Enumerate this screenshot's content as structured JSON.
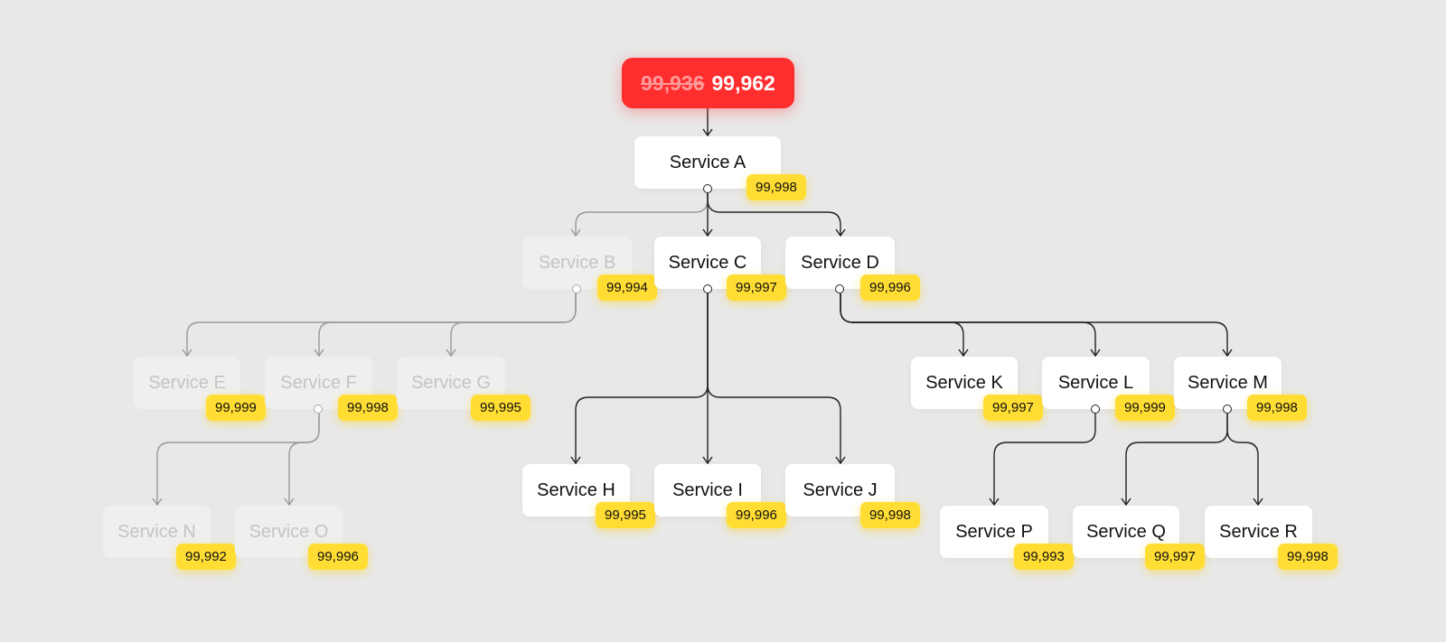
{
  "summary": {
    "old_value": "99,936",
    "new_value": "99,962",
    "color": "#ff2e2e"
  },
  "badge_color": "#ffdd33",
  "nodes": {
    "a": {
      "label": "Service A",
      "value": "99,998",
      "faded": false
    },
    "b": {
      "label": "Service B",
      "value": "99,994",
      "faded": true
    },
    "c": {
      "label": "Service C",
      "value": "99,997",
      "faded": false
    },
    "d": {
      "label": "Service D",
      "value": "99,996",
      "faded": false
    },
    "e": {
      "label": "Service E",
      "value": "99,999",
      "faded": true
    },
    "f": {
      "label": "Service F",
      "value": "99,998",
      "faded": true
    },
    "g": {
      "label": "Service G",
      "value": "99,995",
      "faded": true
    },
    "h": {
      "label": "Service H",
      "value": "99,995",
      "faded": false
    },
    "i": {
      "label": "Service I",
      "value": "99,996",
      "faded": false
    },
    "j": {
      "label": "Service J",
      "value": "99,998",
      "faded": false
    },
    "k": {
      "label": "Service K",
      "value": "99,997",
      "faded": false
    },
    "l": {
      "label": "Service L",
      "value": "99,999",
      "faded": false
    },
    "m": {
      "label": "Service M",
      "value": "99,998",
      "faded": false
    },
    "n": {
      "label": "Service N",
      "value": "99,992",
      "faded": true
    },
    "o": {
      "label": "Service O",
      "value": "99,996",
      "faded": true
    },
    "p": {
      "label": "Service P",
      "value": "99,993",
      "faded": false
    },
    "q": {
      "label": "Service Q",
      "value": "99,997",
      "faded": false
    },
    "r": {
      "label": "Service R",
      "value": "99,998",
      "faded": false
    }
  },
  "edges": [
    [
      "summary",
      "a"
    ],
    [
      "a",
      "b"
    ],
    [
      "a",
      "c"
    ],
    [
      "a",
      "d"
    ],
    [
      "b",
      "e"
    ],
    [
      "b",
      "f"
    ],
    [
      "b",
      "g"
    ],
    [
      "c",
      "h"
    ],
    [
      "c",
      "i"
    ],
    [
      "c",
      "j"
    ],
    [
      "d",
      "k"
    ],
    [
      "d",
      "l"
    ],
    [
      "d",
      "m"
    ],
    [
      "f",
      "n"
    ],
    [
      "f",
      "o"
    ],
    [
      "l",
      "p"
    ],
    [
      "m",
      "q"
    ],
    [
      "m",
      "r"
    ]
  ]
}
